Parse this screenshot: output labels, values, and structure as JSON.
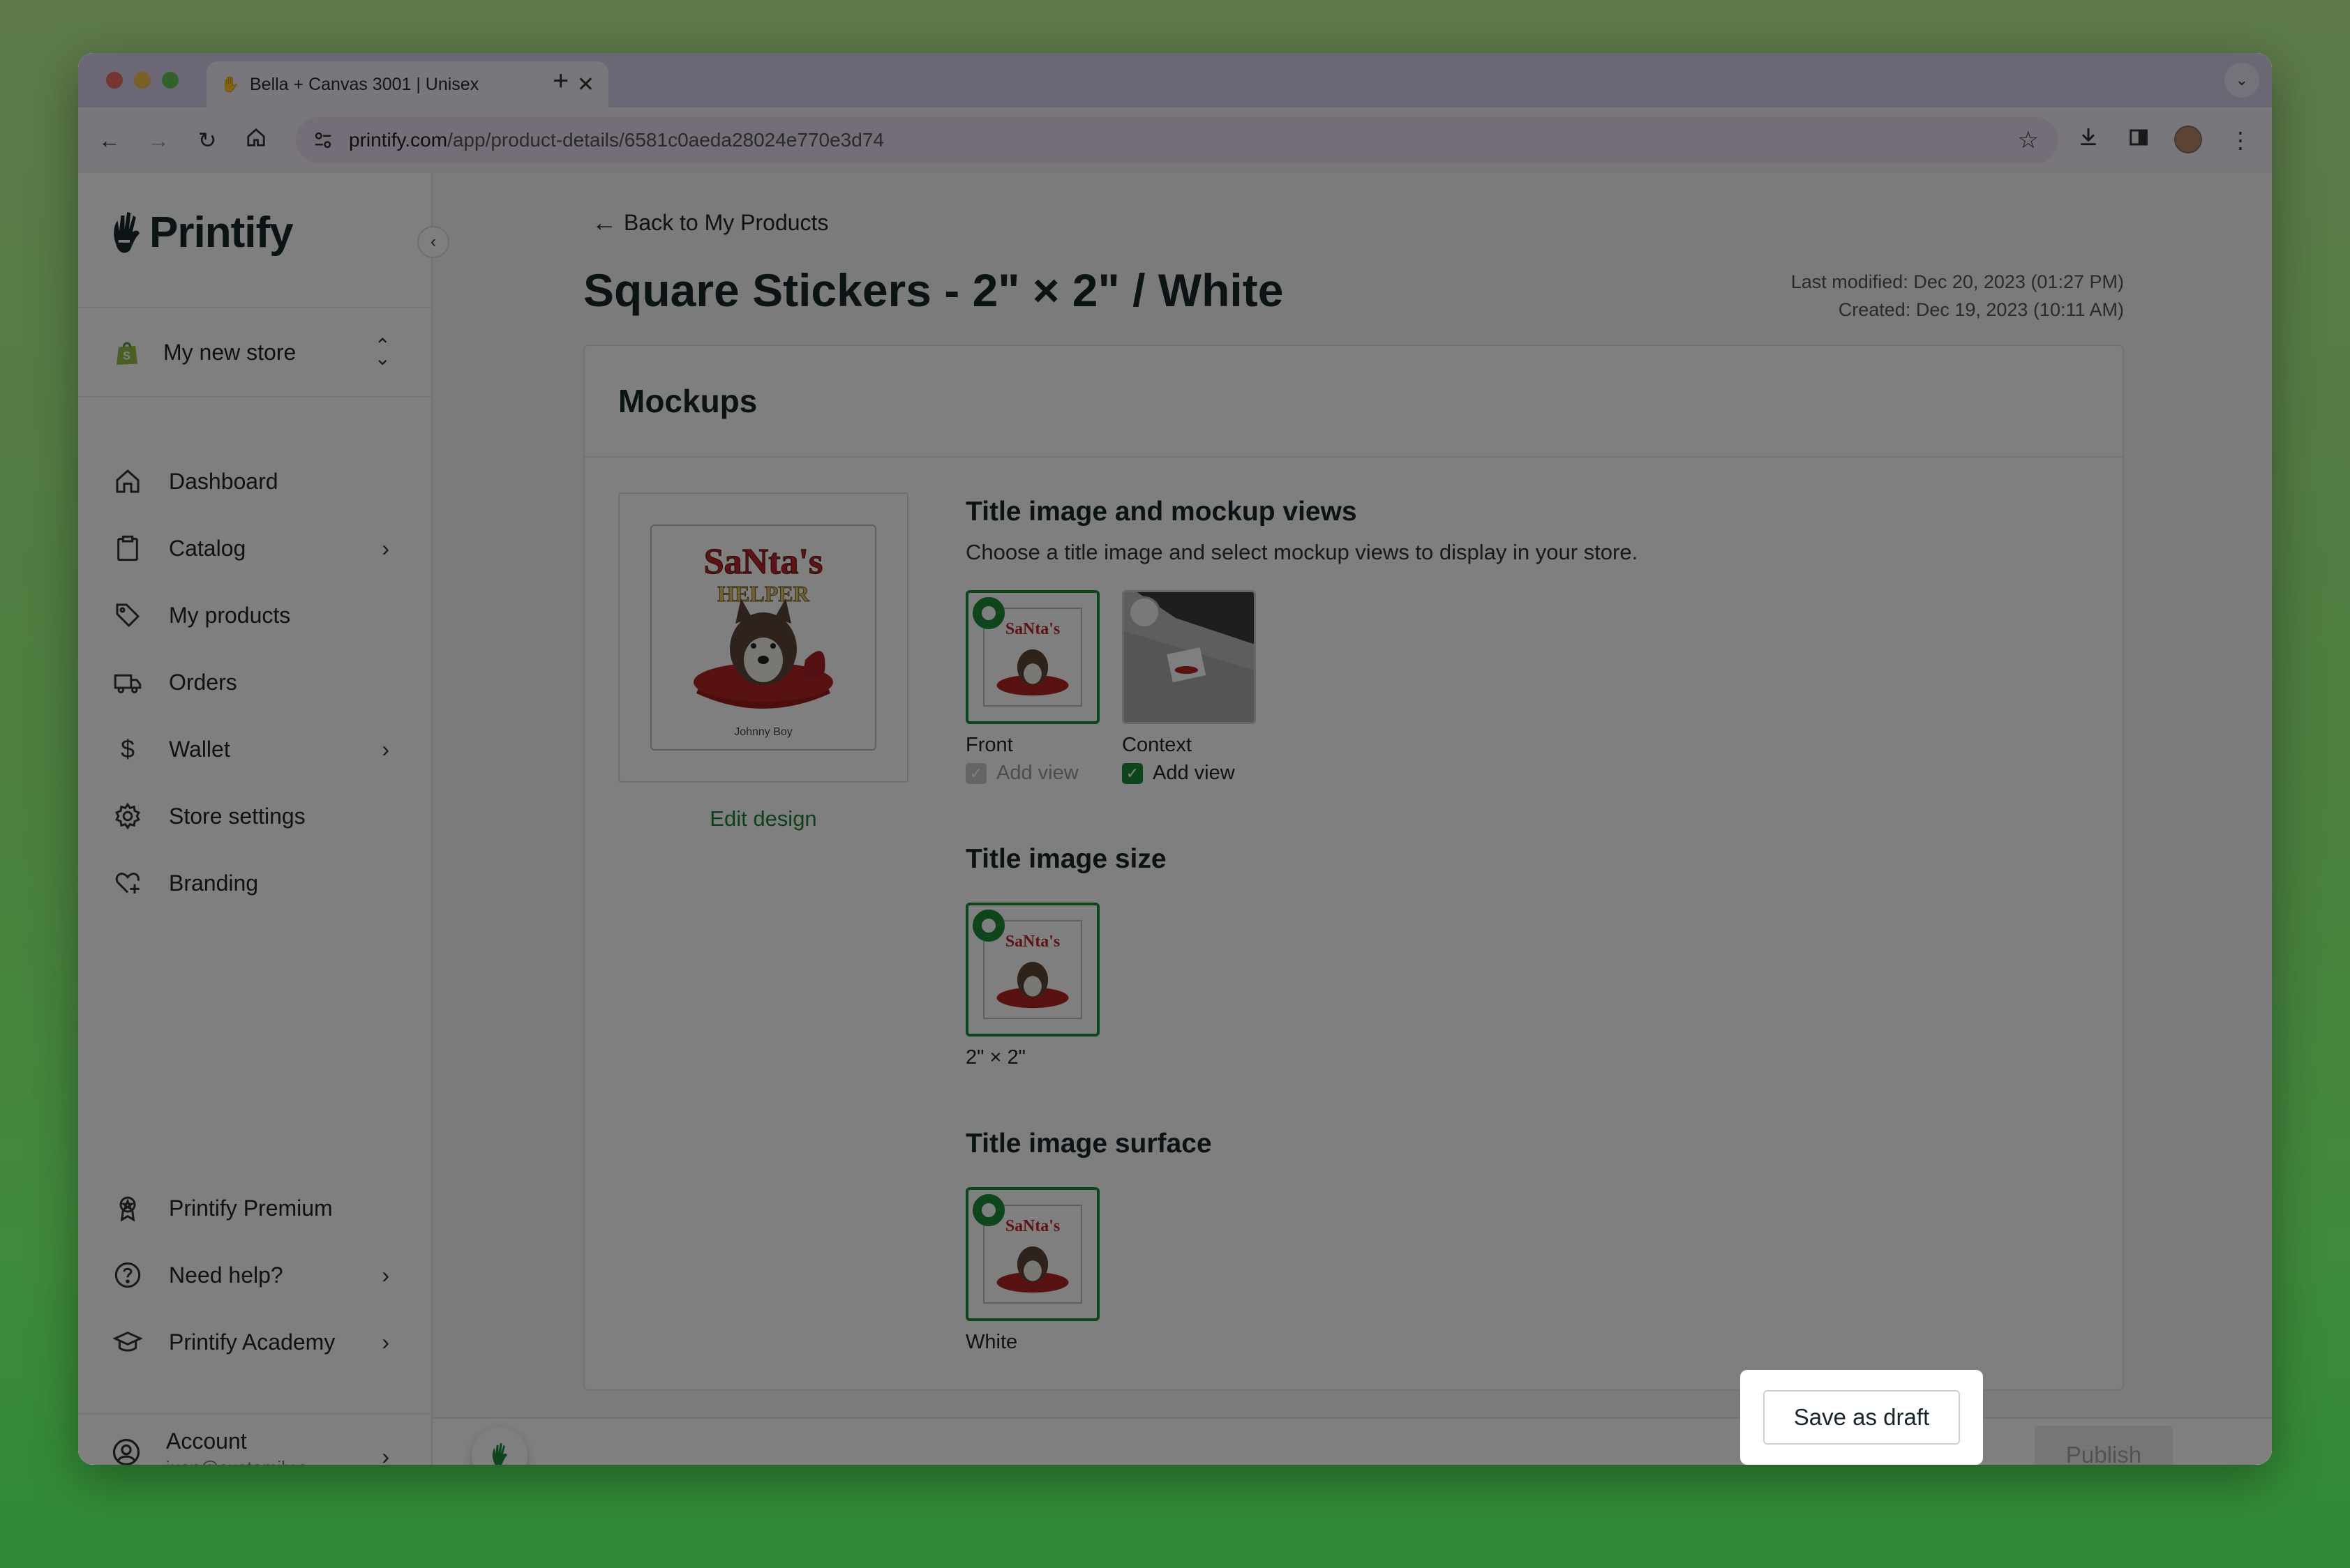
{
  "browser": {
    "tab_title": "Bella + Canvas 3001 | Unisex",
    "url_host": "printify.com",
    "url_path": "/app/product-details/6581c0aeda28024e770e3d74"
  },
  "sidebar": {
    "brand": "Printify",
    "store_name": "My new store",
    "items": [
      {
        "label": "Dashboard",
        "icon": "home-icon"
      },
      {
        "label": "Catalog",
        "icon": "clipboard-icon"
      },
      {
        "label": "My products",
        "icon": "tag-icon"
      },
      {
        "label": "Orders",
        "icon": "truck-icon"
      },
      {
        "label": "Wallet",
        "icon": "dollar-icon"
      },
      {
        "label": "Store settings",
        "icon": "gear-icon"
      },
      {
        "label": "Branding",
        "icon": "heart-plus-icon"
      }
    ],
    "bottom_items": [
      {
        "label": "Printify Premium",
        "icon": "premium-badge-icon"
      },
      {
        "label": "Need help?",
        "icon": "help-circle-icon"
      },
      {
        "label": "Printify Academy",
        "icon": "graduation-cap-icon"
      }
    ],
    "account": {
      "label": "Account",
      "email": "juan@customily.c..."
    }
  },
  "main": {
    "back_link": "Back to My Products",
    "title": "Square Stickers - 2\" × 2\" / White",
    "last_modified": "Last modified: Dec 20, 2023 (01:27 PM)",
    "created": "Created: Dec 19, 2023 (10:11 AM)",
    "card_title": "Mockups",
    "edit_design": "Edit design",
    "sticker_caption": "Johnny Boy",
    "views_heading": "Title image and mockup views",
    "views_desc": "Choose a title image and select mockup views to display in your store.",
    "views": [
      {
        "name": "Front",
        "add_view": "Add view",
        "selected": true
      },
      {
        "name": "Context",
        "add_view": "Add view",
        "selected": false
      }
    ],
    "size_heading": "Title image size",
    "size_option": "2\" × 2\"",
    "surface_heading": "Title image surface",
    "surface_option": "White"
  },
  "footer": {
    "save_draft": "Save as draft",
    "publish": "Publish"
  },
  "colors": {
    "accent": "#1d8a3b",
    "title": "#17262b"
  }
}
